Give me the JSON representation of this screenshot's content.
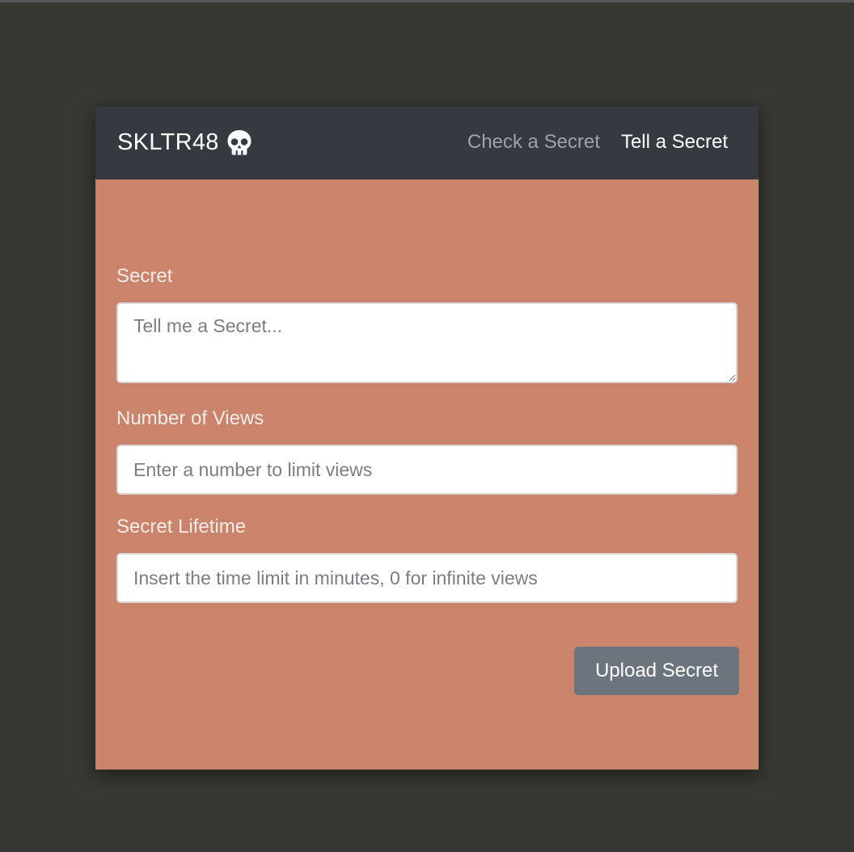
{
  "navbar": {
    "brand": "SKLTR48",
    "brand_icon": "skull-icon",
    "links": [
      {
        "label": "Check a Secret",
        "state": "inactive"
      },
      {
        "label": "Tell a Secret",
        "state": "active"
      }
    ]
  },
  "form": {
    "secret": {
      "label": "Secret",
      "placeholder": "Tell me a Secret...",
      "value": ""
    },
    "views": {
      "label": "Number of Views",
      "placeholder": "Enter a number to limit views",
      "value": ""
    },
    "lifetime": {
      "label": "Secret Lifetime",
      "placeholder": "Insert the time limit in minutes, 0 for infinite views",
      "value": ""
    },
    "submit_label": "Upload Secret"
  },
  "colors": {
    "page_background": "#373833",
    "navbar_background": "#343a40",
    "card_background": "#c9846b",
    "button_background": "#6c757d"
  }
}
